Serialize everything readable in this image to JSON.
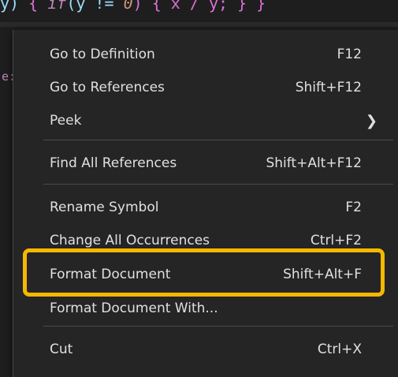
{
  "editor": {
    "code_tokens": {
      "t1": "y)",
      "t2": " { ",
      "t3": "if",
      "t4": "(y != ",
      "t5": "0",
      "t6": ") { x / y; } }"
    },
    "gutter_text": "e:"
  },
  "context_menu": {
    "items": [
      {
        "label": "Go to Definition",
        "shortcut": "F12"
      },
      {
        "label": "Go to References",
        "shortcut": "Shift+F12"
      },
      {
        "label": "Peek",
        "shortcut": ""
      },
      {
        "label": "Find All References",
        "shortcut": "Shift+Alt+F12"
      },
      {
        "label": "Rename Symbol",
        "shortcut": "F2"
      },
      {
        "label": "Change All Occurrences",
        "shortcut": "Ctrl+F2"
      },
      {
        "label": "Format Document",
        "shortcut": "Shift+Alt+F"
      },
      {
        "label": "Format Document With...",
        "shortcut": ""
      },
      {
        "label": "Cut",
        "shortcut": "Ctrl+X"
      }
    ],
    "submenu_icon": "chevron-right-icon",
    "highlight_color": "#f5b800"
  },
  "colors": {
    "menu_background": "#252526",
    "menu_text": "#e0e0e0",
    "editor_background": "#1e1e1e"
  }
}
